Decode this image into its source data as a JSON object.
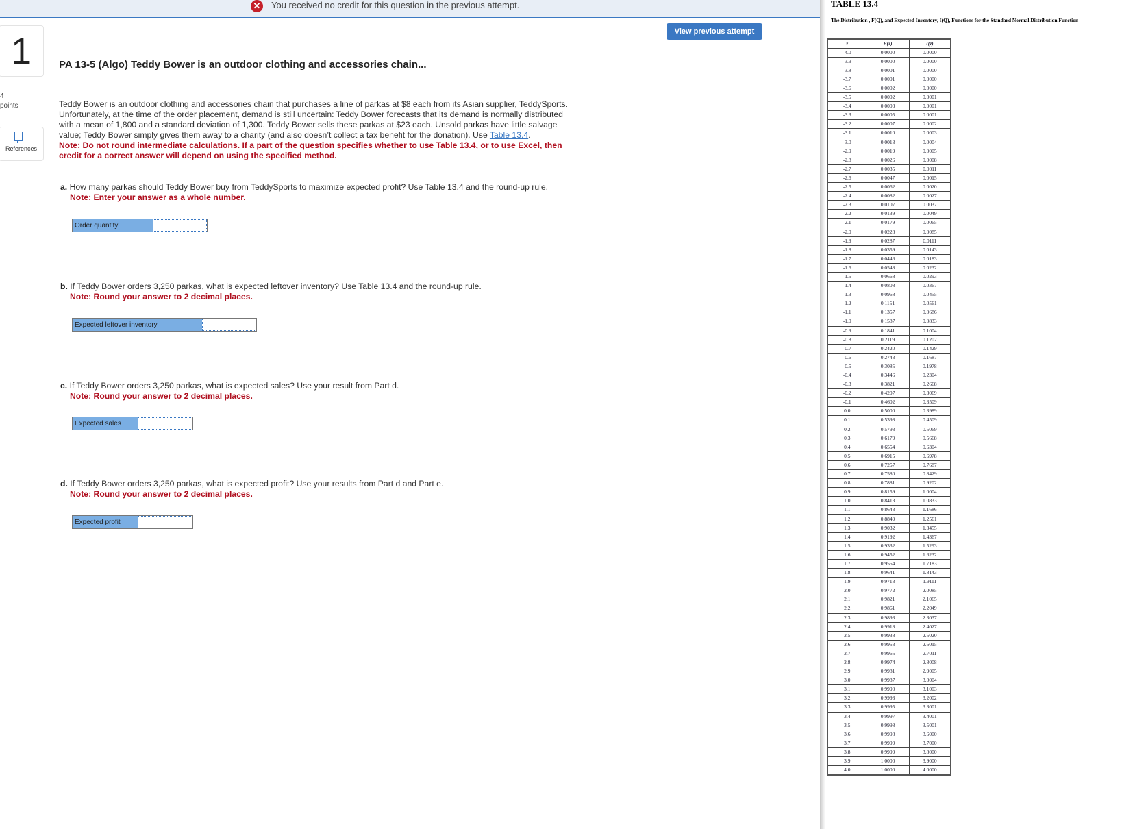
{
  "banner": {
    "icon": "error-circle-icon",
    "message": "You received no credit for this question in the previous attempt."
  },
  "question": {
    "number": "1",
    "points_value": "4",
    "points_label": "points",
    "references_label": "References",
    "view_previous_label": "View previous attempt",
    "title": "PA 13-5 (Algo) Teddy Bower is an outdoor clothing and accessories chain...",
    "body": "Teddy Bower is an outdoor clothing and accessories chain that purchases a line of parkas at $8 each from its Asian supplier, TeddySports. Unfortunately, at the time of the order placement, demand is still uncertain: Teddy Bower forecasts that its demand is normally distributed with a mean of 1,800 and a standard deviation of 1,300. Teddy Bower sells these parkas at $23 each. Unsold parkas have little salvage value; Teddy Bower simply gives them away to a charity (and also doesn’t collect a tax benefit for the donation). Use ",
    "table_link": "Table 13.4",
    "body_end": ".",
    "note": "Note: Do not round intermediate calculations. If a part of the question specifies whether to use Table 13.4, or to use Excel, then credit for a correct answer will depend on using the specified method.",
    "parts": [
      {
        "letter": "a.",
        "text": "How many parkas should Teddy Bower buy from TeddySports to maximize expected profit? Use Table 13.4 and the round-up rule.",
        "note": "Note: Enter your answer as a whole number.",
        "field_label": "Order quantity",
        "value": ""
      },
      {
        "letter": "b.",
        "text": "If Teddy Bower orders 3,250 parkas, what is expected leftover inventory? Use Table 13.4 and the round-up rule.",
        "note": "Note: Round your answer to 2 decimal places.",
        "field_label": "Expected leftover inventory",
        "value": ""
      },
      {
        "letter": "c.",
        "text": "If Teddy Bower orders 3,250 parkas, what is expected sales? Use your result from Part d.",
        "note": "Note: Round your answer to 2 decimal places.",
        "field_label": "Expected sales",
        "value": ""
      },
      {
        "letter": "d.",
        "text": "If Teddy Bower orders 3,250 parkas, what is expected profit? Use your results from Part d and Part e.",
        "note": "Note: Round your answer to 2 decimal places.",
        "field_label": "Expected profit",
        "value": ""
      }
    ]
  },
  "table": {
    "title": "TABLE 13.4",
    "subtitle": "The Distribution , F(Q), and Expected Inventory, I(Q), Functions for the Standard Normal Distribution Function",
    "headers": [
      "z",
      "F(z)",
      "I(z)"
    ],
    "rows": [
      [
        "-4.0",
        "0.0000",
        "0.0000"
      ],
      [
        "-3.9",
        "0.0000",
        "0.0000"
      ],
      [
        "-3.8",
        "0.0001",
        "0.0000"
      ],
      [
        "-3.7",
        "0.0001",
        "0.0000"
      ],
      [
        "-3.6",
        "0.0002",
        "0.0000"
      ],
      [
        "-3.5",
        "0.0002",
        "0.0001"
      ],
      [
        "-3.4",
        "0.0003",
        "0.0001"
      ],
      [
        "-3.3",
        "0.0005",
        "0.0001"
      ],
      [
        "-3.2",
        "0.0007",
        "0.0002"
      ],
      [
        "-3.1",
        "0.0010",
        "0.0003"
      ],
      [
        "-3.0",
        "0.0013",
        "0.0004"
      ],
      [
        "-2.9",
        "0.0019",
        "0.0005"
      ],
      [
        "-2.8",
        "0.0026",
        "0.0008"
      ],
      [
        "-2.7",
        "0.0035",
        "0.0011"
      ],
      [
        "-2.6",
        "0.0047",
        "0.0015"
      ],
      [
        "-2.5",
        "0.0062",
        "0.0020"
      ],
      [
        "-2.4",
        "0.0082",
        "0.0027"
      ],
      [
        "-2.3",
        "0.0107",
        "0.0037"
      ],
      [
        "-2.2",
        "0.0139",
        "0.0049"
      ],
      [
        "-2.1",
        "0.0179",
        "0.0065"
      ],
      [
        "-2.0",
        "0.0228",
        "0.0085"
      ],
      [
        "-1.9",
        "0.0287",
        "0.0111"
      ],
      [
        "-1.8",
        "0.0359",
        "0.0143"
      ],
      [
        "-1.7",
        "0.0446",
        "0.0183"
      ],
      [
        "-1.6",
        "0.0548",
        "0.0232"
      ],
      [
        "-1.5",
        "0.0668",
        "0.0293"
      ],
      [
        "-1.4",
        "0.0808",
        "0.0367"
      ],
      [
        "-1.3",
        "0.0968",
        "0.0455"
      ],
      [
        "-1.2",
        "0.1151",
        "0.0561"
      ],
      [
        "-1.1",
        "0.1357",
        "0.0686"
      ],
      [
        "-1.0",
        "0.1587",
        "0.0833"
      ],
      [
        "-0.9",
        "0.1841",
        "0.1004"
      ],
      [
        "-0.8",
        "0.2119",
        "0.1202"
      ],
      [
        "-0.7",
        "0.2420",
        "0.1429"
      ],
      [
        "-0.6",
        "0.2743",
        "0.1687"
      ],
      [
        "-0.5",
        "0.3085",
        "0.1978"
      ],
      [
        "-0.4",
        "0.3446",
        "0.2304"
      ],
      [
        "-0.3",
        "0.3821",
        "0.2668"
      ],
      [
        "-0.2",
        "0.4207",
        "0.3069"
      ],
      [
        "-0.1",
        "0.4602",
        "0.3509"
      ],
      [
        "0.0",
        "0.5000",
        "0.3989"
      ],
      [
        "0.1",
        "0.5398",
        "0.4509"
      ],
      [
        "0.2",
        "0.5793",
        "0.5069"
      ],
      [
        "0.3",
        "0.6179",
        "0.5668"
      ],
      [
        "0.4",
        "0.6554",
        "0.6304"
      ],
      [
        "0.5",
        "0.6915",
        "0.6978"
      ],
      [
        "0.6",
        "0.7257",
        "0.7687"
      ],
      [
        "0.7",
        "0.7580",
        "0.8429"
      ],
      [
        "0.8",
        "0.7881",
        "0.9202"
      ],
      [
        "0.9",
        "0.8159",
        "1.0004"
      ],
      [
        "1.0",
        "0.8413",
        "1.0833"
      ],
      [
        "1.1",
        "0.8643",
        "1.1686"
      ],
      [
        "1.2",
        "0.8849",
        "1.2561"
      ],
      [
        "1.3",
        "0.9032",
        "1.3455"
      ],
      [
        "1.4",
        "0.9192",
        "1.4367"
      ],
      [
        "1.5",
        "0.9332",
        "1.5293"
      ],
      [
        "1.6",
        "0.9452",
        "1.6232"
      ],
      [
        "1.7",
        "0.9554",
        "1.7183"
      ],
      [
        "1.8",
        "0.9641",
        "1.8143"
      ],
      [
        "1.9",
        "0.9713",
        "1.9111"
      ],
      [
        "2.0",
        "0.9772",
        "2.0085"
      ],
      [
        "2.1",
        "0.9821",
        "2.1065"
      ],
      [
        "2.2",
        "0.9861",
        "2.2049"
      ],
      [
        "2.3",
        "0.9893",
        "2.3037"
      ],
      [
        "2.4",
        "0.9918",
        "2.4027"
      ],
      [
        "2.5",
        "0.9938",
        "2.5020"
      ],
      [
        "2.6",
        "0.9953",
        "2.6015"
      ],
      [
        "2.7",
        "0.9965",
        "2.7011"
      ],
      [
        "2.8",
        "0.9974",
        "2.8008"
      ],
      [
        "2.9",
        "0.9981",
        "2.9005"
      ],
      [
        "3.0",
        "0.9987",
        "3.0004"
      ],
      [
        "3.1",
        "0.9990",
        "3.1003"
      ],
      [
        "3.2",
        "0.9993",
        "3.2002"
      ],
      [
        "3.3",
        "0.9995",
        "3.3001"
      ],
      [
        "3.4",
        "0.9997",
        "3.4001"
      ],
      [
        "3.5",
        "0.9998",
        "3.5001"
      ],
      [
        "3.6",
        "0.9998",
        "3.6000"
      ],
      [
        "3.7",
        "0.9999",
        "3.7000"
      ],
      [
        "3.8",
        "0.9999",
        "3.8000"
      ],
      [
        "3.9",
        "1.0000",
        "3.9000"
      ],
      [
        "4.0",
        "1.0000",
        "4.0000"
      ]
    ]
  },
  "colors": {
    "accent": "#3a78c3",
    "error": "#c5202a",
    "note": "#b01020",
    "field_label_bg": "#7aaee3",
    "banner_bg": "#e8eef6"
  }
}
